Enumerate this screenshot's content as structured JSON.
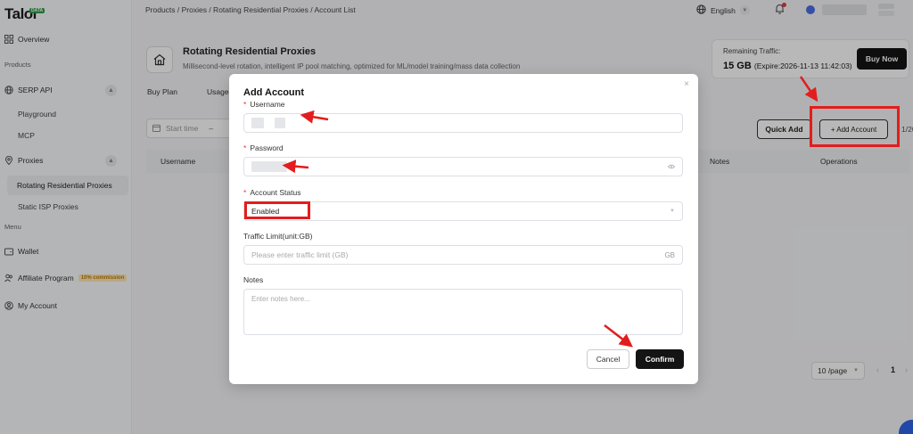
{
  "brand": {
    "name": "Talor",
    "badge": "DATA"
  },
  "sidebar": {
    "overview": "Overview",
    "section_products": "Products",
    "serp_api": "SERP API",
    "playground": "Playground",
    "mcp": "MCP",
    "proxies": "Proxies",
    "rotating": "Rotating Residential Proxies",
    "static_isp": "Static ISP Proxies",
    "section_menu": "Menu",
    "wallet": "Wallet",
    "affiliate": "Affiliate Program",
    "affiliate_badge": "10% commission",
    "my_account": "My Account"
  },
  "topbar": {
    "breadcrumb": "Products / Proxies / Rotating Residential Proxies / Account List",
    "language": "English"
  },
  "product": {
    "title": "Rotating Residential Proxies",
    "description": "Millisecond-level rotation, intelligent IP pool matching, optimized for ML/model training/mass data collection"
  },
  "tabs": [
    "Buy Plan",
    "Usage"
  ],
  "traffic": {
    "label": "Remaining Traffic:",
    "value": "15 GB",
    "expire": "(Expire:2026-11-13 11:42:03)",
    "buy_now": "Buy Now"
  },
  "filters": {
    "start_time_placeholder": "Start time",
    "separator": "–",
    "date_cut": "1/20"
  },
  "actions": {
    "quick_add": "Quick Add",
    "add_account": "+ Add Account"
  },
  "table": {
    "col_username": "Username",
    "col_notes": "Notes",
    "col_operations": "Operations"
  },
  "pagination": {
    "page_size": "10 /page",
    "prev": "‹",
    "page": "1",
    "next": "›"
  },
  "modal": {
    "title": "Add Account",
    "close": "×",
    "username_label": "Username",
    "password_label": "Password",
    "status_label": "Account Status",
    "status_value": "Enabled",
    "traffic_label": "Traffic Limit(unit:GB)",
    "traffic_placeholder": "Please enter traffic limit (GB)",
    "traffic_suffix": "GB",
    "notes_label": "Notes",
    "notes_placeholder": "Enter notes here...",
    "cancel": "Cancel",
    "confirm": "Confirm",
    "required_mark": "*"
  },
  "colors": {
    "annotation_red": "#e31d1d",
    "primary_dark": "#141414"
  }
}
